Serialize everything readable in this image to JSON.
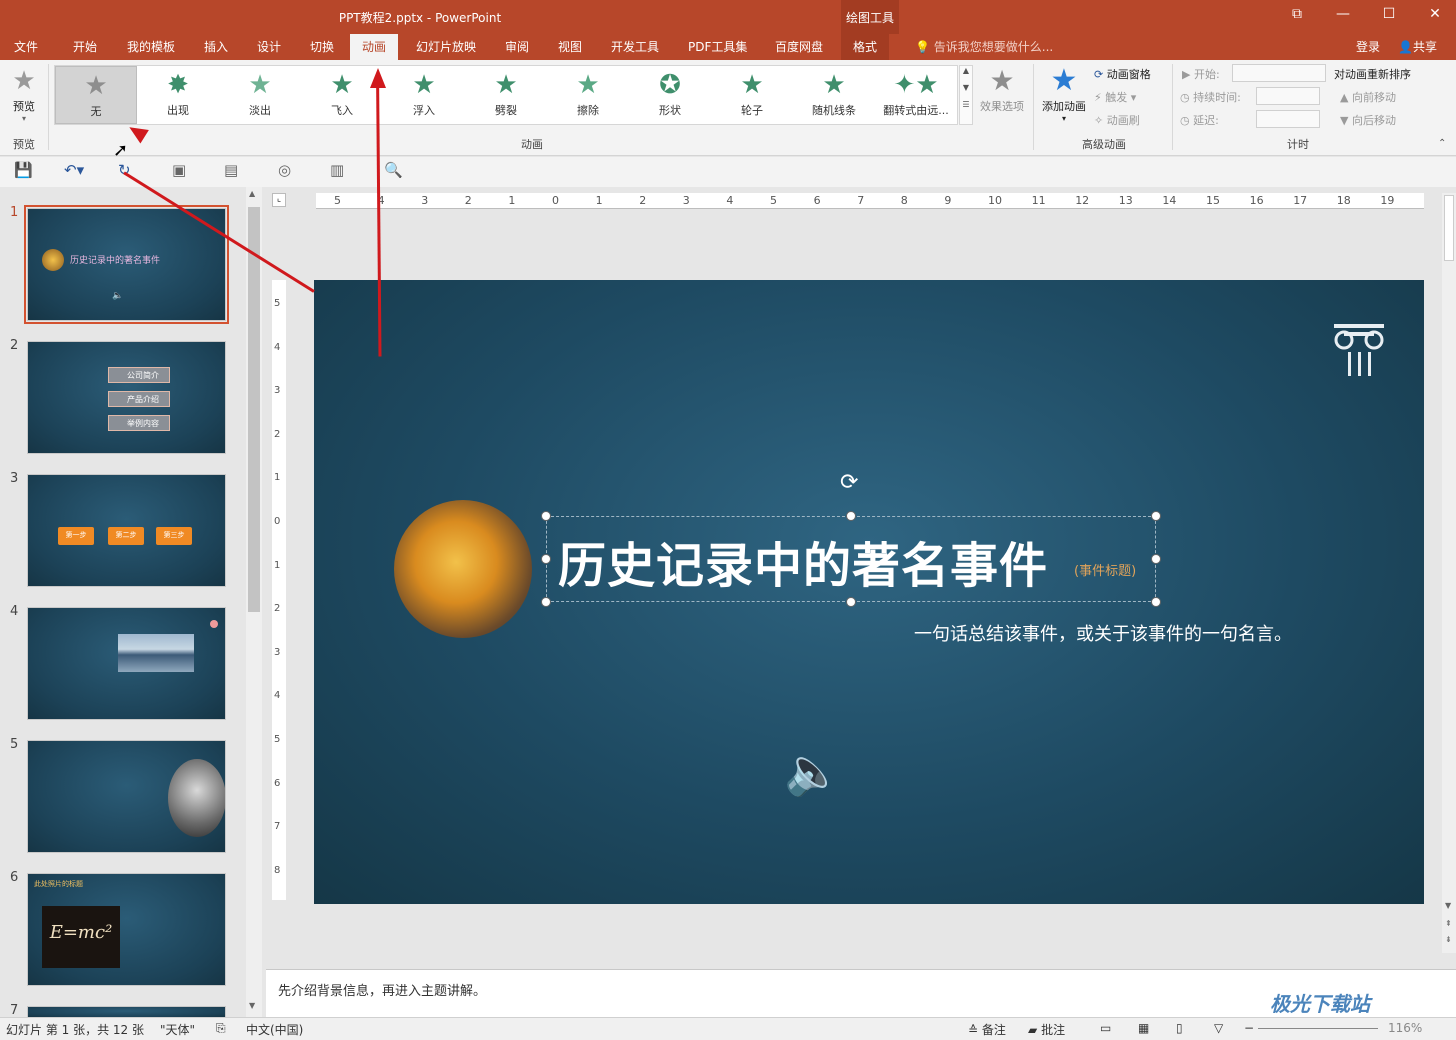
{
  "window": {
    "title": "PPT教程2.pptx - PowerPoint",
    "context_tab_group": "绘图工具",
    "controls": [
      "⧉",
      "—",
      "☐",
      "✕"
    ]
  },
  "tabs": [
    "文件",
    "开始",
    "我的模板",
    "插入",
    "设计",
    "切换",
    "动画",
    "幻灯片放映",
    "审阅",
    "视图",
    "开发工具",
    "PDF工具集",
    "百度网盘",
    "格式"
  ],
  "active_tab": "动画",
  "tell_me": "告诉我您想要做什么...",
  "login": "登录",
  "share": "共享",
  "ribbon": {
    "preview_label": "预览",
    "preview_group": "预览",
    "animations": [
      "无",
      "出现",
      "淡出",
      "飞入",
      "浮入",
      "劈裂",
      "擦除",
      "形状",
      "轮子",
      "随机线条",
      "翻转式由远..."
    ],
    "selected_animation": "无",
    "animation_group": "动画",
    "effect_options": "效果选项",
    "add_animation": "添加动画",
    "animation_pane": "动画窗格",
    "trigger": "触发",
    "animation_painter": "动画刷",
    "advanced_group": "高级动画",
    "start_label": "开始:",
    "duration_label": "持续时间:",
    "delay_label": "延迟:",
    "reorder_title": "对动画重新排序",
    "move_earlier": "向前移动",
    "move_later": "向后移动",
    "timing_group": "计时"
  },
  "thumbnails": {
    "numbers": [
      "1",
      "2",
      "3",
      "4",
      "5",
      "6",
      "7"
    ],
    "slide1_title": "历史记录中的著名事件",
    "slide2_items": [
      "公司简介",
      "产品介绍",
      "举例内容"
    ],
    "slide3_steps": [
      "第一步",
      "第二步",
      "第三步"
    ],
    "slide6_title": "此处照片的标题",
    "slide6_formula": "E=mc²"
  },
  "ruler": {
    "h_ticks": [
      "5",
      "4",
      "3",
      "2",
      "1",
      "0",
      "1",
      "2",
      "3",
      "4",
      "5",
      "6",
      "7",
      "8",
      "9",
      "10",
      "11",
      "12",
      "13",
      "14",
      "15",
      "16",
      "17",
      "18",
      "19"
    ],
    "v_ticks": [
      "5",
      "4",
      "3",
      "2",
      "1",
      "0",
      "1",
      "2",
      "3",
      "4",
      "5",
      "6",
      "7",
      "8"
    ]
  },
  "slide": {
    "title": "历史记录中的著名事件",
    "title_tag": "(事件标题)",
    "subtitle": "一句话总结该事件，或关于该事件的一句名言。"
  },
  "notes": "先介绍背景信息，再进入主题讲解。",
  "status": {
    "slide_info": "幻灯片 第 1 张，共 12 张",
    "theme": "\"天体\"",
    "language": "中文(中国)",
    "notes_btn": "备注",
    "comments_btn": "批注",
    "zoom": "116%"
  },
  "watermark": "极光下载站",
  "colors": {
    "accent": "#b7472a",
    "slide_bg": "#1e4a62",
    "arrow": "#d0191d",
    "star": "#3f8f6c"
  }
}
